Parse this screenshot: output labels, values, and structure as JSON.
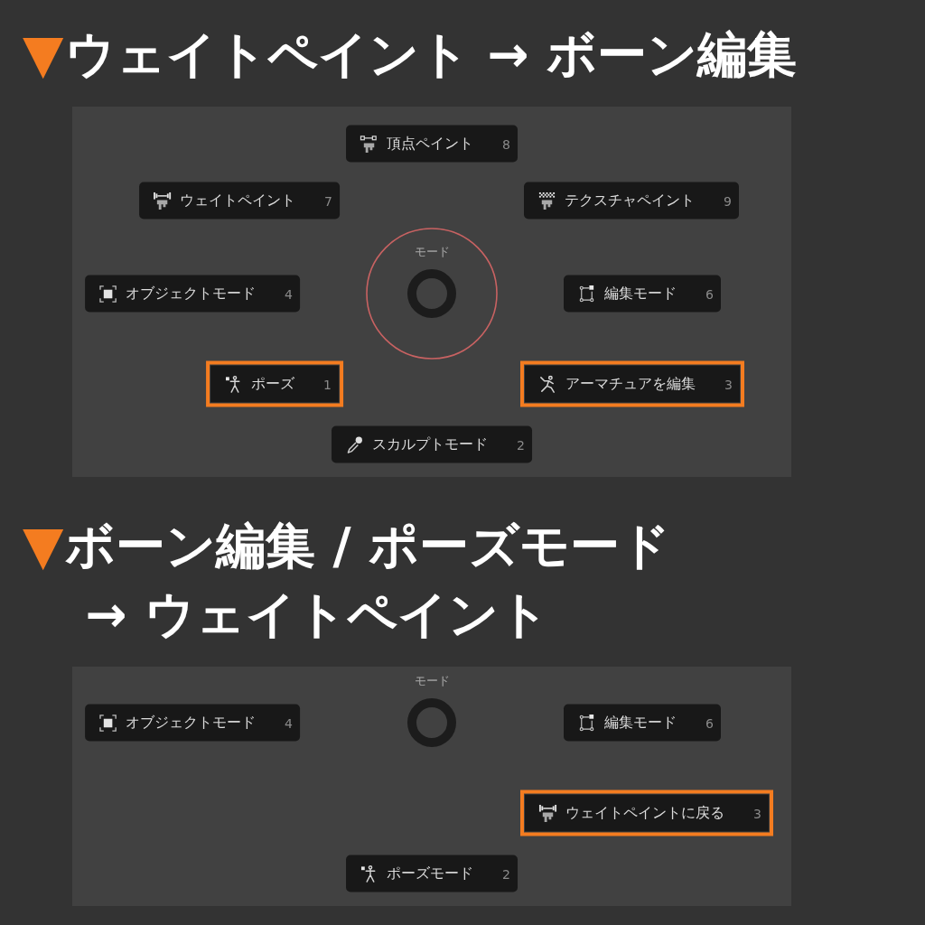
{
  "sections": [
    {
      "heading": {
        "marker": "▼",
        "lines": [
          "ウェイトペイント → ボーン編集"
        ]
      },
      "pie_menu": {
        "title": "モード",
        "cursor_ring": true,
        "north": {
          "label": "頂点ペイント",
          "hotkey": "8",
          "kind": "vertexpaint",
          "highlighted": false
        },
        "north_west": {
          "label": "ウェイトペイント",
          "hotkey": "7",
          "kind": "weightpaint",
          "highlighted": false
        },
        "north_east": {
          "label": "テクスチャペイント",
          "hotkey": "9",
          "kind": "texturepaint",
          "highlighted": false
        },
        "west": {
          "label": "オブジェクトモード",
          "hotkey": "4",
          "kind": "object",
          "highlighted": false
        },
        "east": {
          "label": "編集モード",
          "hotkey": "6",
          "kind": "edit",
          "highlighted": false
        },
        "south_west": {
          "label": "ポーズ",
          "hotkey": "1",
          "kind": "pose",
          "highlighted": true
        },
        "south_east": {
          "label": "アーマチュアを編集",
          "hotkey": "3",
          "kind": "armature",
          "highlighted": true
        },
        "south": {
          "label": "スカルプトモード",
          "hotkey": "2",
          "kind": "sculpt",
          "highlighted": false
        }
      }
    },
    {
      "heading": {
        "marker": "▼",
        "lines": [
          "ボーン編集 / ポーズモード",
          "→ ウェイトペイント"
        ]
      },
      "pie_menu": {
        "title": "モード",
        "cursor_ring": false,
        "west": {
          "label": "オブジェクトモード",
          "hotkey": "4",
          "kind": "object",
          "highlighted": false
        },
        "east": {
          "label": "編集モード",
          "hotkey": "6",
          "kind": "edit",
          "highlighted": false
        },
        "south_east": {
          "label": "ウェイトペイントに戻る",
          "hotkey": "3",
          "kind": "weightpaint",
          "highlighted": true
        },
        "south": {
          "label": "ポーズモード",
          "hotkey": "2",
          "kind": "pose",
          "highlighted": false
        }
      }
    }
  ]
}
